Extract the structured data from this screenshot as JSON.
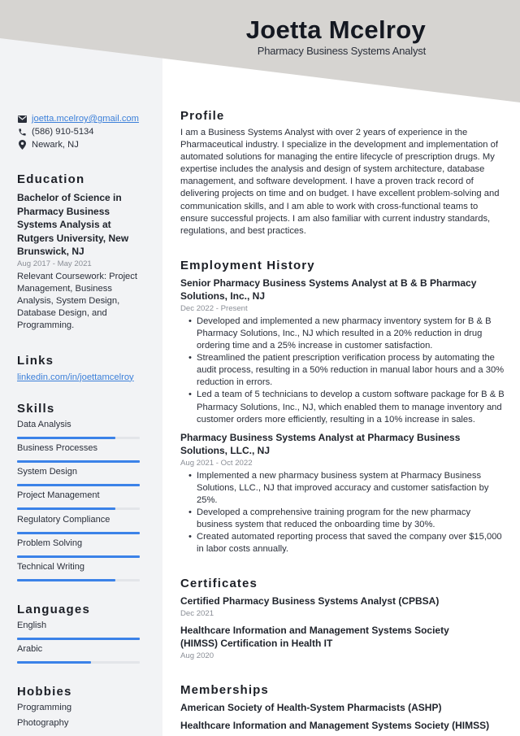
{
  "header": {
    "name": "Joetta Mcelroy",
    "title": "Pharmacy Business Systems Analyst"
  },
  "colors": {
    "header_bg": "#d6d4d1",
    "sidebar_bg": "#f2f3f5",
    "accent": "#3b82e8",
    "link": "#3b7fd9"
  },
  "contact": {
    "email": "joetta.mcelroy@gmail.com",
    "phone": "(586) 910-5134",
    "location": "Newark, NJ",
    "icons": [
      "envelope-icon",
      "phone-icon",
      "map-pin-icon"
    ]
  },
  "education": {
    "heading": "Education",
    "degree": "Bachelor of Science in Pharmacy Business Systems Analysis at Rutgers University, New Brunswick, NJ",
    "dates": "Aug 2017 - May 2021",
    "description": "Relevant Coursework: Project Management, Business Analysis, System Design, Database Design, and Programming."
  },
  "links": {
    "heading": "Links",
    "items": [
      "linkedin.com/in/joettamcelroy"
    ]
  },
  "skills": {
    "heading": "Skills",
    "items": [
      {
        "label": "Data Analysis",
        "level": 0.8
      },
      {
        "label": "Business Processes",
        "level": 1.0
      },
      {
        "label": "System Design",
        "level": 1.0
      },
      {
        "label": "Project Management",
        "level": 0.8
      },
      {
        "label": "Regulatory Compliance",
        "level": 1.0
      },
      {
        "label": "Problem Solving",
        "level": 1.0
      },
      {
        "label": "Technical Writing",
        "level": 0.8
      }
    ]
  },
  "languages": {
    "heading": "Languages",
    "items": [
      {
        "label": "English",
        "level": 1.0
      },
      {
        "label": "Arabic",
        "level": 0.6
      }
    ]
  },
  "hobbies": {
    "heading": "Hobbies",
    "items": [
      "Programming",
      "Photography"
    ]
  },
  "profile": {
    "heading": "Profile",
    "text": "I am a Business Systems Analyst with over 2 years of experience in the Pharmaceutical industry. I specialize in the development and implementation of automated solutions for managing the entire lifecycle of prescription drugs. My expertise includes the analysis and design of system architecture, database management, and software development. I have a proven track record of delivering projects on time and on budget. I have excellent problem-solving and communication skills, and I am able to work with cross-functional teams to ensure successful projects. I am also familiar with current industry standards, regulations, and best practices."
  },
  "employment": {
    "heading": "Employment History",
    "jobs": [
      {
        "title": "Senior Pharmacy Business Systems Analyst at B & B Pharmacy Solutions, Inc., NJ",
        "dates": "Dec 2022 - Present",
        "bullets": [
          "Developed and implemented a new pharmacy inventory system for B & B Pharmacy Solutions, Inc., NJ which resulted in a 20% reduction in drug ordering time and a 25% increase in customer satisfaction.",
          "Streamlined the patient prescription verification process by automating the audit process, resulting in a 50% reduction in manual labor hours and a 30% reduction in errors.",
          "Led a team of 5 technicians to develop a custom software package for B & B Pharmacy Solutions, Inc., NJ, which enabled them to manage inventory and customer orders more efficiently, resulting in a 10% increase in sales."
        ]
      },
      {
        "title": "Pharmacy Business Systems Analyst at Pharmacy Business Solutions, LLC., NJ",
        "dates": "Aug 2021 - Oct 2022",
        "bullets": [
          "Implemented a new pharmacy business system at Pharmacy Business Solutions, LLC., NJ that improved accuracy and customer satisfaction by 25%.",
          "Developed a comprehensive training program for the new pharmacy business system that reduced the onboarding time by 30%.",
          "Created automated reporting process that saved the company over $15,000 in labor costs annually."
        ]
      }
    ]
  },
  "certificates": {
    "heading": "Certificates",
    "items": [
      {
        "title": "Certified Pharmacy Business Systems Analyst (CPBSA)",
        "date": "Dec 2021"
      },
      {
        "title": "Healthcare Information and Management Systems Society (HIMSS) Certification in Health IT",
        "date": "Aug 2020"
      }
    ]
  },
  "memberships": {
    "heading": "Memberships",
    "items": [
      "American Society of Health-System Pharmacists (ASHP)",
      "Healthcare Information and Management Systems Society (HIMSS)"
    ]
  }
}
